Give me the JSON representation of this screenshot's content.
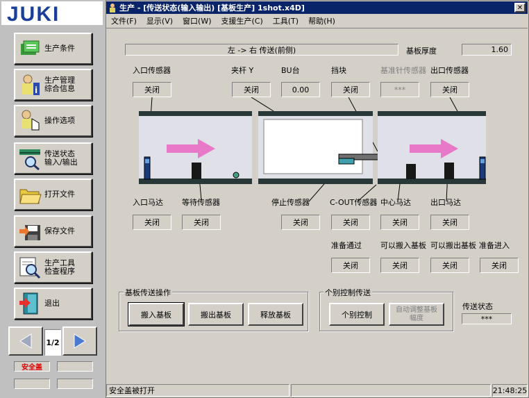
{
  "brand": {
    "logo_text": "JUKI"
  },
  "sidebar": {
    "items": [
      {
        "label": "生产条件",
        "icon": "production-condition-icon"
      },
      {
        "label": "生产管理\n综合信息",
        "icon": "production-info-icon"
      },
      {
        "label": "操作选项",
        "icon": "operation-option-icon"
      },
      {
        "label": "传送状态\n输入/输出",
        "icon": "transfer-status-icon"
      },
      {
        "label": "打开文件",
        "icon": "open-folder-icon"
      },
      {
        "label": "保存文件",
        "icon": "save-file-icon"
      },
      {
        "label": "生产工具\n检查程序",
        "icon": "tool-check-icon"
      },
      {
        "label": "退出",
        "icon": "exit-door-icon"
      }
    ],
    "page_indicator": "1/2",
    "safety_cover": "安全盖"
  },
  "window": {
    "title": "生产 - [传送状态(输入输出) [基板生产] 1shot.x4D]",
    "close": "✕",
    "menu": [
      "文件(F)",
      "显示(V)",
      "窗口(W)",
      "支援生产(C)",
      "工具(T)",
      "帮助(H)"
    ]
  },
  "transfer": {
    "direction": "左 -> 右 传送(前侧)",
    "board_thickness_label": "基板厚度",
    "board_thickness_value": "1.60"
  },
  "sensors_top": [
    {
      "label": "入口传感器",
      "value": "关闭"
    },
    {
      "label": "夹杆 Y",
      "value": "关闭"
    },
    {
      "label": "BU台",
      "value": "0.00"
    },
    {
      "label": "挡块",
      "value": "关闭"
    },
    {
      "label": "基准针传感器",
      "value": "***"
    },
    {
      "label": "出口传感器",
      "value": "关闭"
    }
  ],
  "sensors_bottom": [
    {
      "label": "入口马达",
      "value": "关闭"
    },
    {
      "label": "等待传感器",
      "value": "关闭"
    },
    {
      "label": "停止传感器",
      "value": "关闭"
    },
    {
      "label": "C-OUT传感器",
      "value": "关闭"
    },
    {
      "label": "中心马达",
      "value": "关闭"
    },
    {
      "label": "出口马达",
      "value": "关闭"
    }
  ],
  "signals": [
    {
      "label": "准备通过",
      "value": "关闭"
    },
    {
      "label": "可以搬入基板",
      "value": "关闭"
    },
    {
      "label": "可以搬出基板",
      "value": "关闭"
    },
    {
      "label": "准备进入",
      "value": "关闭"
    }
  ],
  "board_ops": {
    "title": "基板传送操作",
    "load": "搬入基板",
    "unload": "搬出基板",
    "release": "释放基板"
  },
  "individual": {
    "title": "个别控制传送",
    "control": "个别控制",
    "auto_adjust": "自动调整基板\n幅度"
  },
  "transfer_status": {
    "label": "传送状态",
    "value": "***"
  },
  "status_bar": {
    "message": "安全盖被打开",
    "time": "21:48:25"
  },
  "colors": {
    "title_bg": "#0a246a",
    "arrow": "#e878c8",
    "rail": "#283838",
    "sensor": "#1a3a7a"
  }
}
